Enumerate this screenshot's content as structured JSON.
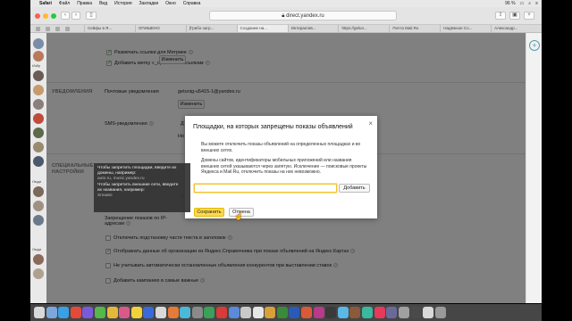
{
  "menubar": {
    "app_name": "Safari",
    "items": [
      "Файл",
      "Правка",
      "Вид",
      "История",
      "Закладки",
      "Окно",
      "Справка"
    ],
    "battery": "96 %"
  },
  "browser": {
    "url": "direct.yandex.ru",
    "tabs": [
      "Сейфы в Я...",
      "ОПИШЕНО",
      "[Грибо-загр...",
      "Создание на...",
      "Интерактив...",
      "https://gelun...",
      "Почта Mail.Ru",
      "Надёжное Co...",
      "Александр..."
    ]
  },
  "page": {
    "metrika_label": "Размечать ссылки для Метрики",
    "openstat_label": "Добавить метку «_openstat» к ссылкам",
    "change_label": "Изменить",
    "notifications_section": "УВЕДОМЛЕНИЯ",
    "mail_notifications_label": "Почтовые уведомления",
    "mail_value": "getunig-u5415-1@yandex.ru",
    "sms_label": "SMS-уведомления",
    "special_section_line1": "СПЕЦИАЛЬНЫЕ",
    "special_section_line2": "НАСТРОЙКИ",
    "ip_ban_label_line1": "Запрещение показов по IP-",
    "ip_ban_label_line2": "адресам",
    "checkbox_title_disable": "Отключить подстановку части текста в заголовок",
    "checkbox_org_data": "Отображать данные об организации из Яндекс.Справочника при показе объявлений на Яндекс.Картах",
    "checkbox_auto_stop": "Не учитывать автоматически остановленные объявления конкурентов при выставлении ставок",
    "checkbox_important": "Добавить кампанию в самые важные",
    "partial_do": "Д",
    "partial_no": "Но",
    "partial_d": "Д"
  },
  "modal": {
    "title": "Площадки, на которых запрещены показы объявлений",
    "close": "×",
    "para1": "Вы можете отключить показы объявлений на определенных площадках и во внешних сетях.",
    "para2": "Домены сайтов, идентификаторы мобильных приложений или названия внешних сетей указываются через запятую. Исключение — поисковые проекты Яндекса и Mail.Ru, отключить показы на них невозможно.",
    "input_value": "",
    "add_button": "Добавить",
    "save_button": "Сохранить",
    "cancel_button": "Отмена"
  },
  "tooltip": {
    "line1": "Чтобы запретить площадки, введите их",
    "line2": "домены, например:",
    "example1": "auto.ru, music.yandex.ru",
    "line3": "Чтобы запретить внешние сети, введите",
    "line4": "их названия, например:",
    "example2": "Smaato"
  },
  "sidebar": {
    "label1": "Избр",
    "label2": "Люди",
    "label3": "Люди"
  },
  "colors": {
    "accent_yellow": "#ffdb4d",
    "overlay": "rgba(0,0,0,0.48)"
  }
}
